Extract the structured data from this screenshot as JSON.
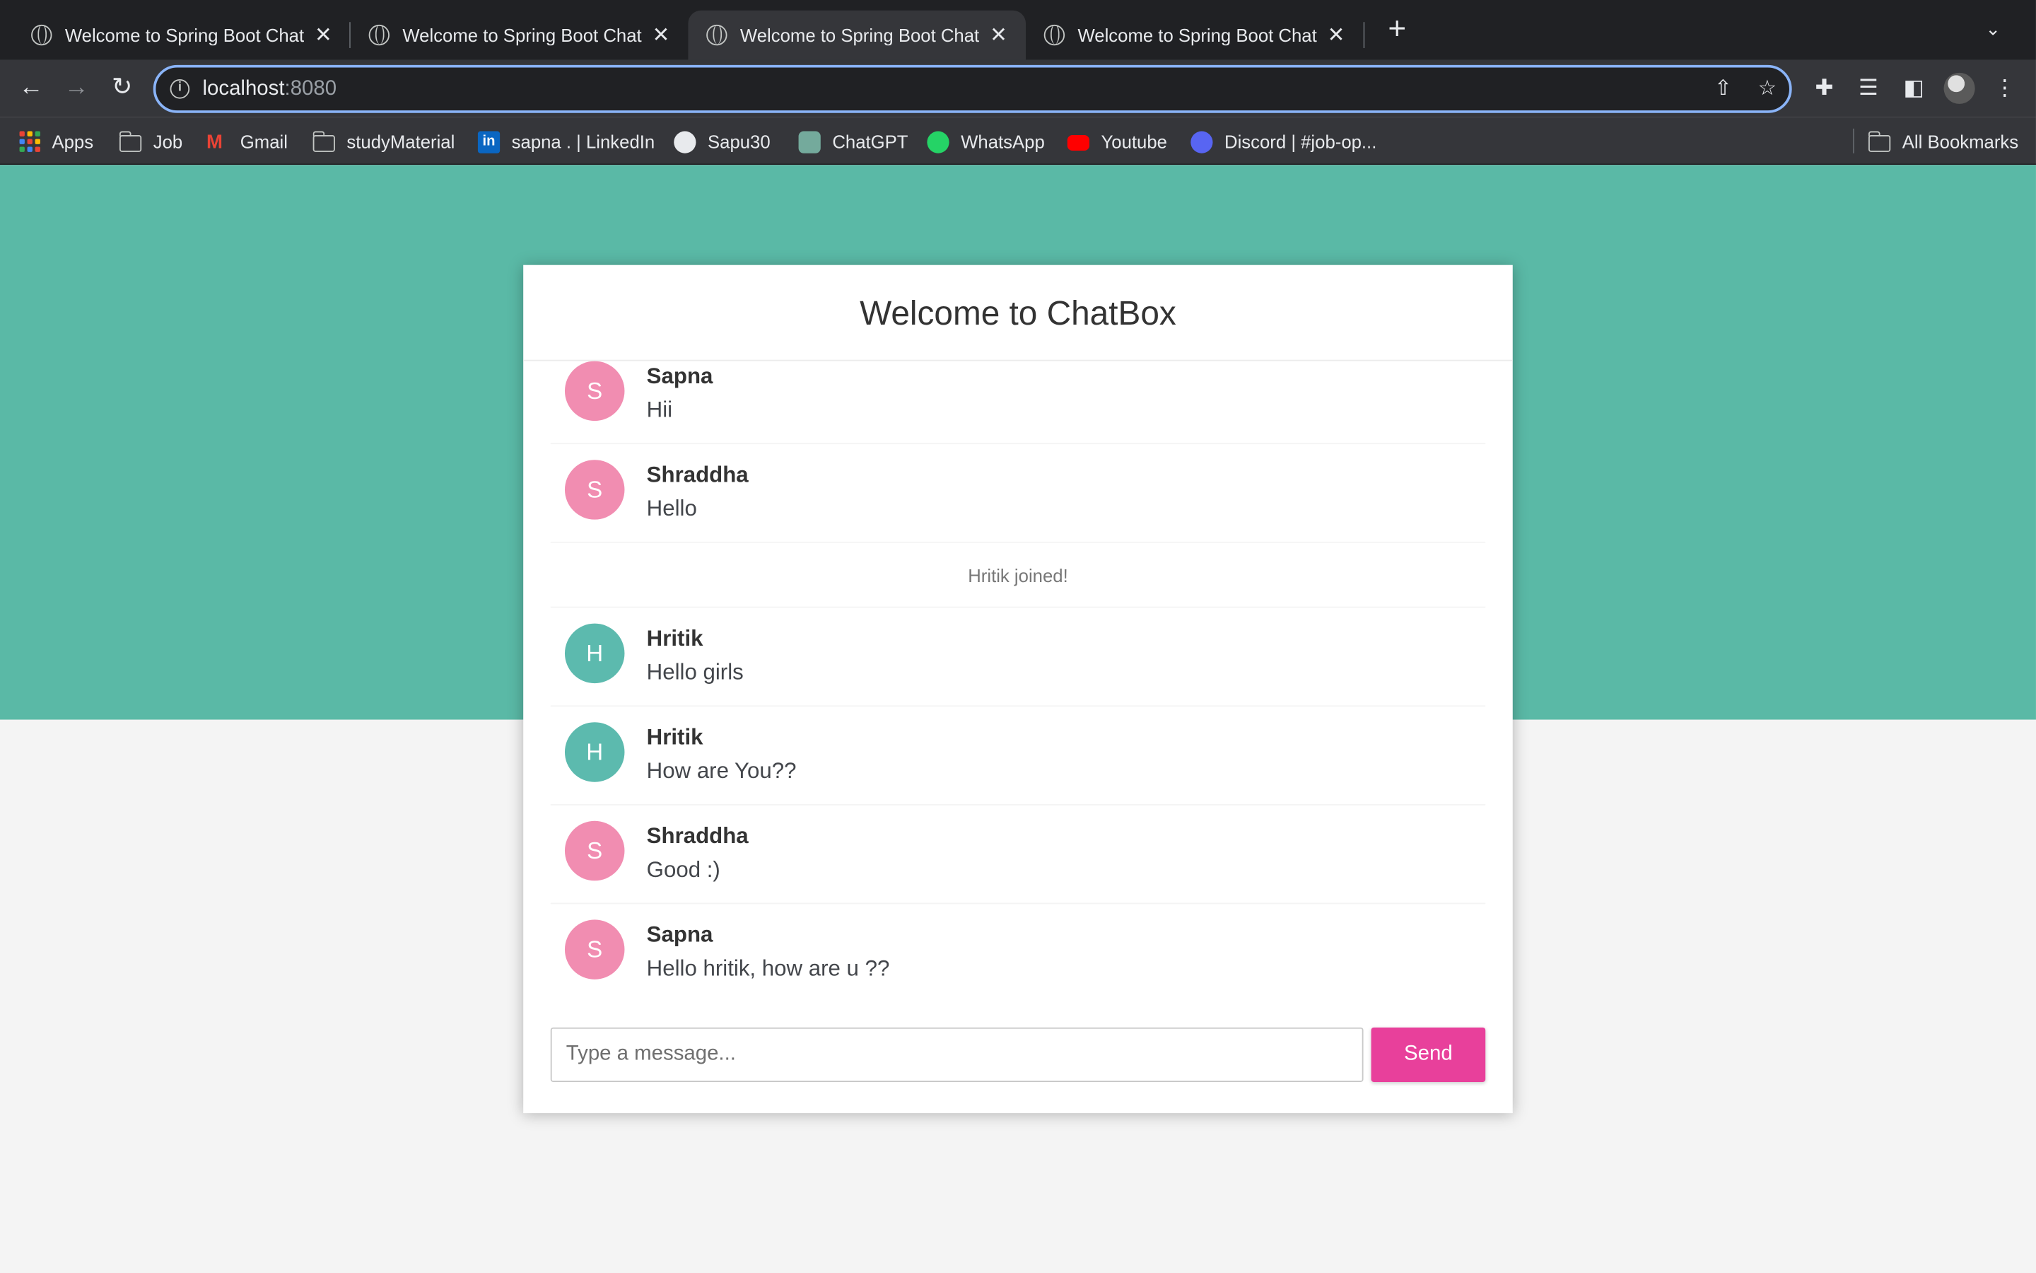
{
  "browser": {
    "tabs": [
      {
        "title": "Welcome to Spring Boot Chat",
        "active": false
      },
      {
        "title": "Welcome to Spring Boot Chat",
        "active": false
      },
      {
        "title": "Welcome to Spring Boot Chat",
        "active": true
      },
      {
        "title": "Welcome to Spring Boot Chat",
        "active": false
      }
    ],
    "url_host": "localhost",
    "url_port": ":8080",
    "bookmarks": [
      {
        "label": "Apps",
        "icon": "apps-grid-icon"
      },
      {
        "label": "Job",
        "icon": "folder-icon"
      },
      {
        "label": "Gmail",
        "icon": "gmail-icon"
      },
      {
        "label": "studyMaterial",
        "icon": "folder-icon"
      },
      {
        "label": "sapna . | LinkedIn",
        "icon": "linkedin-icon"
      },
      {
        "label": "Sapu30",
        "icon": "github-icon"
      },
      {
        "label": "ChatGPT",
        "icon": "chatgpt-icon"
      },
      {
        "label": "WhatsApp",
        "icon": "whatsapp-icon"
      },
      {
        "label": "Youtube",
        "icon": "youtube-icon"
      },
      {
        "label": "Discord | #job-op...",
        "icon": "discord-icon"
      }
    ],
    "all_bookmarks": "All Bookmarks"
  },
  "chat": {
    "title": "Welcome to ChatBox",
    "messages": [
      {
        "type": "chat",
        "initial": "S",
        "sender": "Sapna",
        "text": "Hii",
        "color": "#f18db1"
      },
      {
        "type": "chat",
        "initial": "S",
        "sender": "Shraddha",
        "text": "Hello",
        "color": "#f18db1"
      },
      {
        "type": "event",
        "text": "Hritik joined!"
      },
      {
        "type": "chat",
        "initial": "H",
        "sender": "Hritik",
        "text": "Hello girls",
        "color": "#5cbaae"
      },
      {
        "type": "chat",
        "initial": "H",
        "sender": "Hritik",
        "text": "How are You??",
        "color": "#5cbaae"
      },
      {
        "type": "chat",
        "initial": "S",
        "sender": "Shraddha",
        "text": "Good :)",
        "color": "#f18db1"
      },
      {
        "type": "chat",
        "initial": "S",
        "sender": "Sapna",
        "text": "Hello hritik, how are u ??",
        "color": "#f18db1"
      }
    ],
    "input_placeholder": "Type a message...",
    "input_value": "",
    "send_label": "Send"
  },
  "colors": {
    "hero": "#5ab9a6",
    "send_button": "#e8409b",
    "avatar_pink": "#f18db1",
    "avatar_teal": "#5cbaae"
  }
}
